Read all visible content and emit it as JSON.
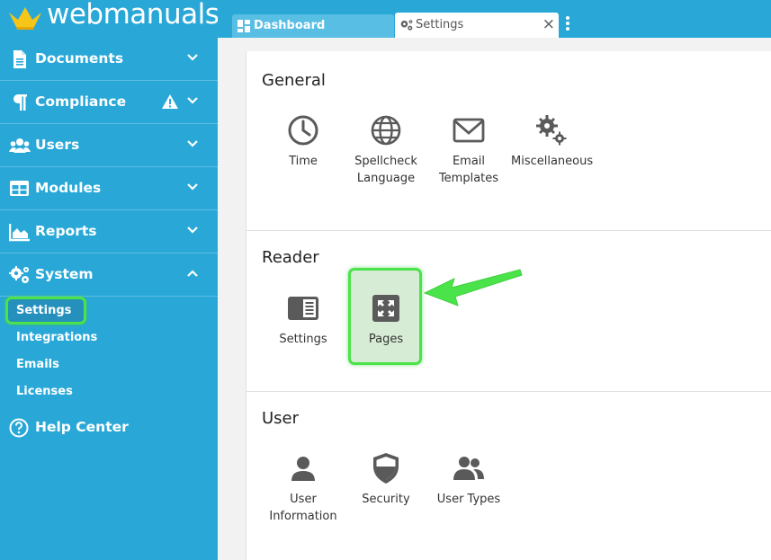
{
  "brand": {
    "name": "webmanuals"
  },
  "sidebar": {
    "items": [
      {
        "label": "Documents"
      },
      {
        "label": "Compliance"
      },
      {
        "label": "Users"
      },
      {
        "label": "Modules"
      },
      {
        "label": "Reports"
      },
      {
        "label": "System"
      }
    ],
    "system_subitems": [
      {
        "label": "Settings"
      },
      {
        "label": "Integrations"
      },
      {
        "label": "Emails"
      },
      {
        "label": "Licenses"
      }
    ],
    "help": {
      "label": "Help Center"
    }
  },
  "tabs": {
    "dashboard": {
      "label": "Dashboard"
    },
    "settings": {
      "label": "Settings",
      "close": "×"
    }
  },
  "sections": {
    "general": {
      "title": "General",
      "tiles": [
        {
          "line1": "Time",
          "line2": ""
        },
        {
          "line1": "Spellcheck",
          "line2": "Language"
        },
        {
          "line1": "Email",
          "line2": "Templates"
        },
        {
          "line1": "Miscellaneous",
          "line2": ""
        }
      ]
    },
    "reader": {
      "title": "Reader",
      "tiles": [
        {
          "line1": "Settings",
          "line2": ""
        },
        {
          "line1": "Pages",
          "line2": ""
        }
      ]
    },
    "user": {
      "title": "User",
      "tiles": [
        {
          "line1": "User",
          "line2": "Information"
        },
        {
          "line1": "Security",
          "line2": ""
        },
        {
          "line1": "User Types",
          "line2": ""
        }
      ]
    }
  },
  "colors": {
    "sidebar": "#29a8d8",
    "highlight": "#4be34a",
    "icon": "#5a5a5a",
    "crown": "#f5c518"
  }
}
